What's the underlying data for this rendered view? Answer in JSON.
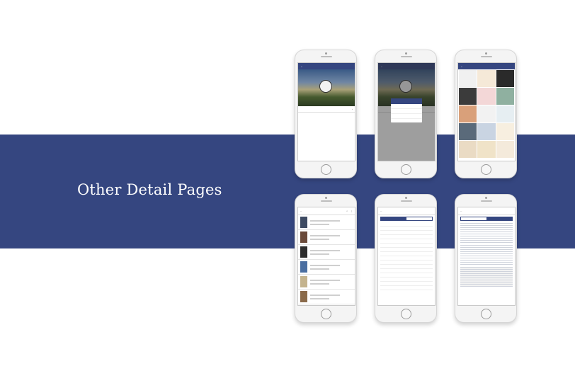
{
  "headline": "Other Detail Pages",
  "colors": {
    "accent": "#354680",
    "background": "#ffffff"
  }
}
